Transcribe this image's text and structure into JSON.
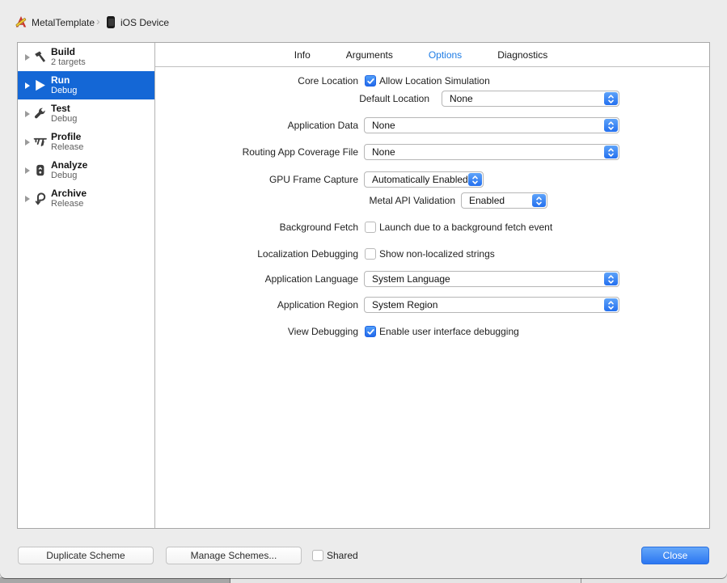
{
  "breadcrumb": {
    "project": "MetalTemplate",
    "separator": "›",
    "destination": "iOS Device"
  },
  "sidebar": {
    "items": [
      {
        "title": "Build",
        "subtitle": "2 targets",
        "icon": "hammer-icon",
        "selected": false
      },
      {
        "title": "Run",
        "subtitle": "Debug",
        "icon": "play-icon",
        "selected": true
      },
      {
        "title": "Test",
        "subtitle": "Debug",
        "icon": "wrench-icon",
        "selected": false
      },
      {
        "title": "Profile",
        "subtitle": "Release",
        "icon": "caliper-icon",
        "selected": false
      },
      {
        "title": "Analyze",
        "subtitle": "Debug",
        "icon": "analyze-icon",
        "selected": false
      },
      {
        "title": "Archive",
        "subtitle": "Release",
        "icon": "archive-icon",
        "selected": false
      }
    ]
  },
  "tabs": {
    "items": [
      {
        "label": "Info",
        "selected": false
      },
      {
        "label": "Arguments",
        "selected": false
      },
      {
        "label": "Options",
        "selected": true
      },
      {
        "label": "Diagnostics",
        "selected": false
      }
    ]
  },
  "form": {
    "core_location": {
      "label": "Core Location",
      "checkbox_label": "Allow Location Simulation",
      "checked": true
    },
    "default_location": {
      "label": "Default Location",
      "value": "None"
    },
    "application_data": {
      "label": "Application Data",
      "value": "None"
    },
    "routing_app_coverage": {
      "label": "Routing App Coverage File",
      "value": "None"
    },
    "gpu_frame_capture": {
      "label": "GPU Frame Capture",
      "value": "Automatically Enabled"
    },
    "metal_api_validation": {
      "label": "Metal API Validation",
      "value": "Enabled"
    },
    "background_fetch": {
      "label": "Background Fetch",
      "checkbox_label": "Launch due to a background fetch event",
      "checked": false
    },
    "localization_debugging": {
      "label": "Localization Debugging",
      "checkbox_label": "Show non-localized strings",
      "checked": false
    },
    "application_language": {
      "label": "Application Language",
      "value": "System Language"
    },
    "application_region": {
      "label": "Application Region",
      "value": "System Region"
    },
    "view_debugging": {
      "label": "View Debugging",
      "checkbox_label": "Enable user interface debugging",
      "checked": true
    }
  },
  "footer": {
    "duplicate_scheme": "Duplicate Scheme",
    "manage_schemes": "Manage Schemes...",
    "shared": {
      "label": "Shared",
      "checked": false
    },
    "close": "Close"
  },
  "colors": {
    "selection_blue": "#1467d6",
    "control_blue": "#2e7bf3",
    "tab_active_blue": "#1e7ce5"
  }
}
